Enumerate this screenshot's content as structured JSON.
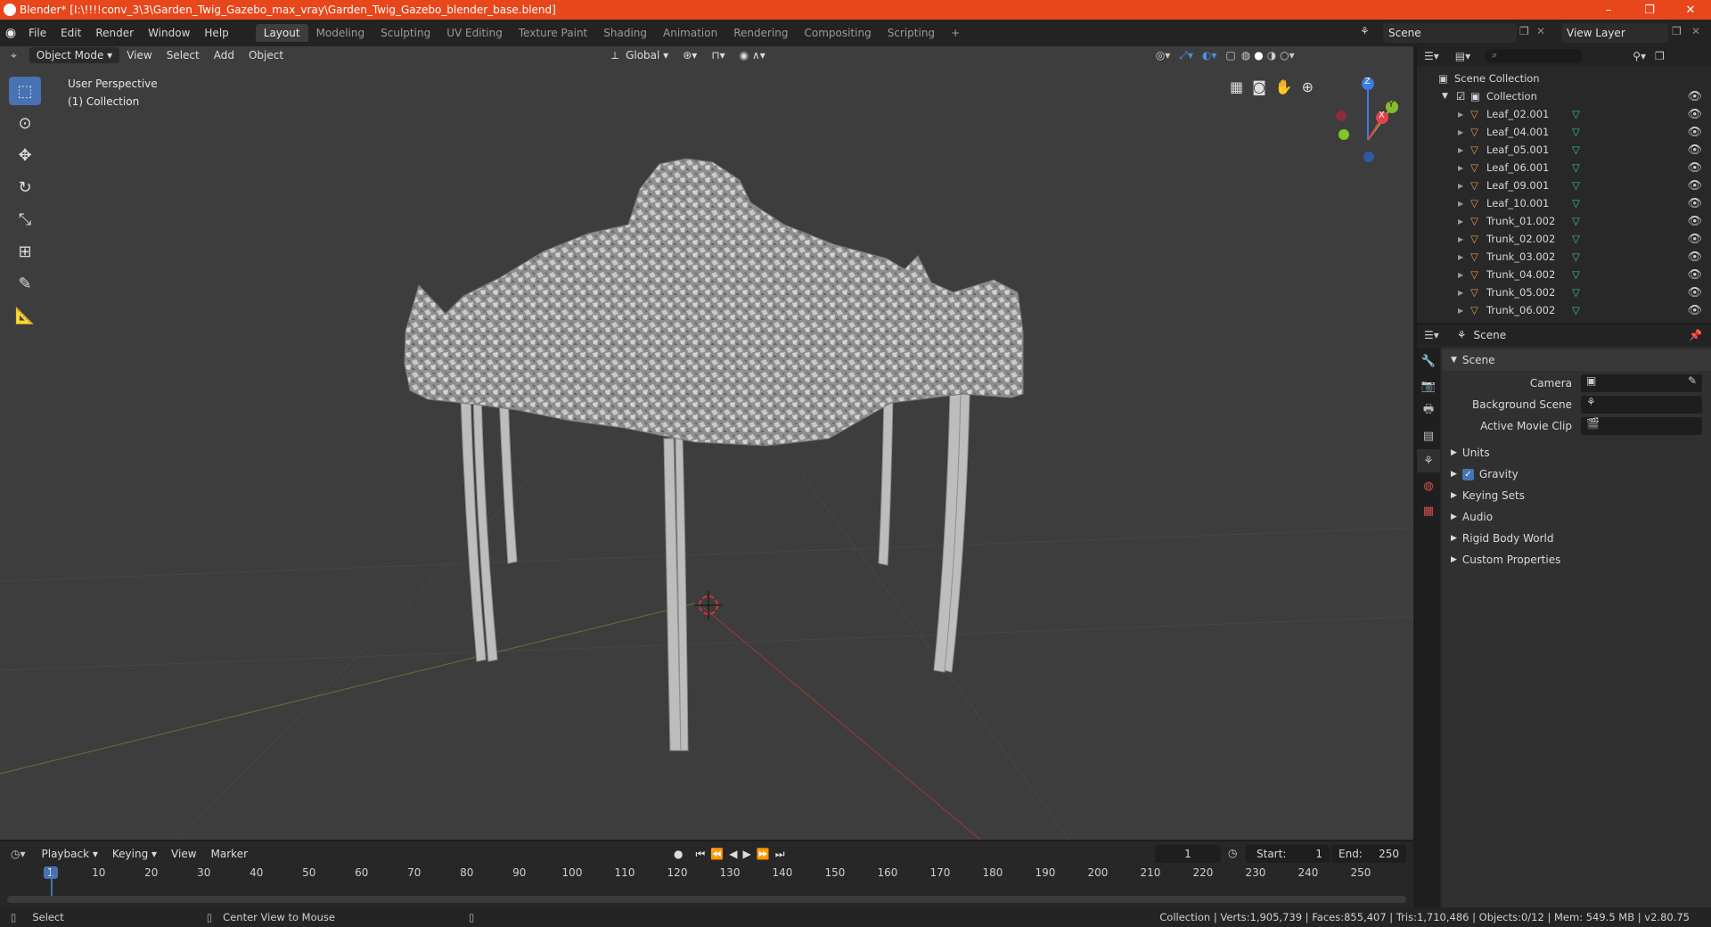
{
  "window": {
    "title": "Blender* [I:\\!!!!conv_3\\3\\Garden_Twig_Gazebo_max_vray\\Garden_Twig_Gazebo_blender_base.blend]",
    "controls": [
      "–",
      "❐",
      "✕"
    ]
  },
  "menu": [
    "File",
    "Edit",
    "Render",
    "Window",
    "Help"
  ],
  "workspaces": [
    "Layout",
    "Modeling",
    "Sculpting",
    "UV Editing",
    "Texture Paint",
    "Shading",
    "Animation",
    "Rendering",
    "Compositing",
    "Scripting"
  ],
  "active_workspace": "Layout",
  "add_workspace": "+",
  "scene_selector": "Scene",
  "view_layer": "View Layer",
  "viewport": {
    "mode": "Object Mode",
    "menus": [
      "View",
      "Select",
      "Add",
      "Object"
    ],
    "transform": "Global",
    "info_line1": "User Perspective",
    "info_line2": "(1) Collection",
    "gizmo_axes": [
      "Z",
      "Y",
      "X"
    ]
  },
  "tools": [
    "select-box",
    "cursor",
    "move",
    "rotate",
    "scale",
    "transform",
    "annotate",
    "measure"
  ],
  "outliner": {
    "root": "Scene Collection",
    "collection": "Collection",
    "items": [
      "Leaf_02.001",
      "Leaf_04.001",
      "Leaf_05.001",
      "Leaf_06.001",
      "Leaf_09.001",
      "Leaf_10.001",
      "Trunk_01.002",
      "Trunk_02.002",
      "Trunk_03.002",
      "Trunk_04.002",
      "Trunk_05.002",
      "Trunk_06.002"
    ]
  },
  "properties": {
    "context": "Scene",
    "panel": "Scene",
    "camera_label": "Camera",
    "bg_scene_label": "Background Scene",
    "movie_clip_label": "Active Movie Clip",
    "sections": [
      "Units",
      "Gravity",
      "Keying Sets",
      "Audio",
      "Rigid Body World",
      "Custom Properties"
    ],
    "gravity_checked": true
  },
  "timeline": {
    "menus": [
      "Playback",
      "Keying",
      "View",
      "Marker"
    ],
    "current_frame": "1",
    "start_label": "Start:",
    "start": "1",
    "end_label": "End:",
    "end": "250",
    "ticks": [
      "1",
      "10",
      "20",
      "30",
      "40",
      "50",
      "60",
      "70",
      "80",
      "90",
      "100",
      "110",
      "120",
      "130",
      "140",
      "150",
      "160",
      "170",
      "180",
      "190",
      "200",
      "210",
      "220",
      "230",
      "240",
      "250"
    ]
  },
  "status": {
    "left": "Select",
    "middle": "Center View to Mouse",
    "stats": "Collection | Verts:1,905,739 | Faces:855,407 | Tris:1,710,486 | Objects:0/12 | Mem: 549.5 MB | v2.80.75"
  },
  "colors": {
    "titlebar": "#e8461b",
    "accent": "#4772b3",
    "mesh_icon": "#e59a3a",
    "data_icon": "#37c08a"
  }
}
